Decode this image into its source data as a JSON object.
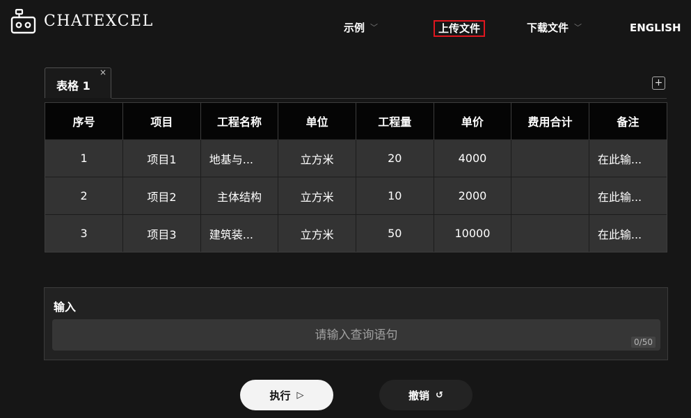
{
  "app": {
    "logo_text": "CHATEXCEL"
  },
  "nav": {
    "examples": "示例",
    "upload": "上传文件",
    "download": "下载文件",
    "language": "ENGLISH"
  },
  "highlight_color": "#e0161f",
  "tabs": [
    {
      "label": "表格 1",
      "close": "×"
    }
  ],
  "add_tab": "+",
  "table": {
    "headers": [
      "序号",
      "项目",
      "工程名称",
      "单位",
      "工程量",
      "单价",
      "费用合计",
      "备注"
    ],
    "rows": [
      [
        "1",
        "项目1",
        "地基与...",
        "立方米",
        "20",
        "4000",
        "",
        "在此输..."
      ],
      [
        "2",
        "项目2",
        "主体结构",
        "立方米",
        "10",
        "2000",
        "",
        "在此输..."
      ],
      [
        "3",
        "项目3",
        "建筑装...",
        "立方米",
        "50",
        "10000",
        "",
        "在此输..."
      ]
    ]
  },
  "input": {
    "label": "输入",
    "placeholder": "请输入查询语句",
    "value": "",
    "counter": "0/50"
  },
  "buttons": {
    "run": "执行",
    "run_icon": "▷",
    "undo": "撤销",
    "undo_icon": "↺"
  }
}
